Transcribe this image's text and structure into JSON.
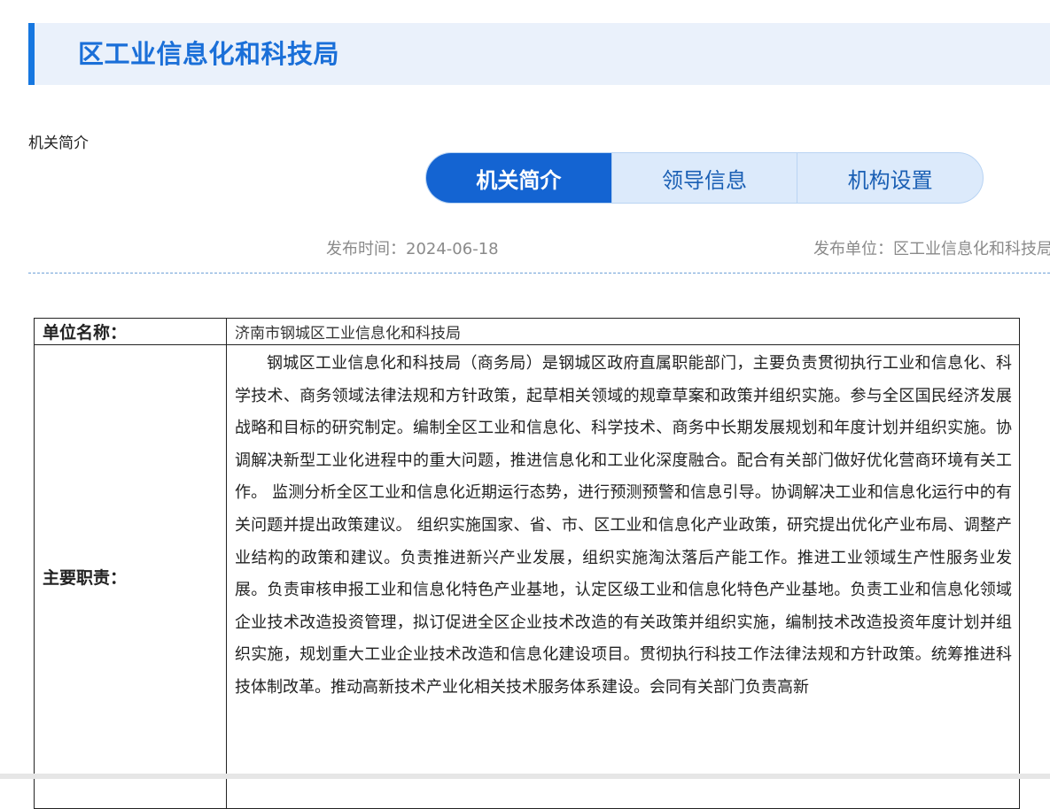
{
  "page_title": "区工业信息化和科技局",
  "breadcrumb": "机关简介",
  "tabs": [
    {
      "label": "机关简介",
      "active": true
    },
    {
      "label": "领导信息",
      "active": false
    },
    {
      "label": "机构设置",
      "active": false
    }
  ],
  "meta": {
    "publish_time": "发布时间：2024-06-18",
    "publish_unit": "发布单位：区工业信息化和科技局"
  },
  "table": {
    "rows": [
      {
        "label": "单位名称：",
        "value": "济南市钢城区工业信息化和科技局"
      },
      {
        "label": "主要职责：",
        "value": "钢城区工业信息化和科技局（商务局）是钢城区政府直属职能部门，主要负责贯彻执行工业和信息化、科学技术、商务领域法律法规和方针政策，起草相关领域的规章草案和政策并组织实施。参与全区国民经济发展战略和目标的研究制定。编制全区工业和信息化、科学技术、商务中长期发展规划和年度计划并组织实施。协调解决新型工业化进程中的重大问题，推进信息化和工业化深度融合。配合有关部门做好优化营商环境有关工作。 监测分析全区工业和信息化近期运行态势，进行预测预警和信息引导。协调解决工业和信息化运行中的有关问题并提出政策建议。 组织实施国家、省、市、区工业和信息化产业政策，研究提出优化产业布局、调整产业结构的政策和建议。负责推进新兴产业发展，组织实施淘汰落后产能工作。推进工业领域生产性服务业发展。负责审核申报工业和信息化特色产业基地，认定区级工业和信息化特色产业基地。负责工业和信息化领域企业技术改造投资管理，拟订促进全区企业技术改造的有关政策并组织实施，编制技术改造投资年度计划并组织实施，规划重大工业企业技术改造和信息化建设项目。贯彻执行科技工作法律法规和方针政策。统筹推进科技体制改革。推动高新技术产业化相关技术服务体系建设。会同有关部门负责高新"
      }
    ]
  }
}
